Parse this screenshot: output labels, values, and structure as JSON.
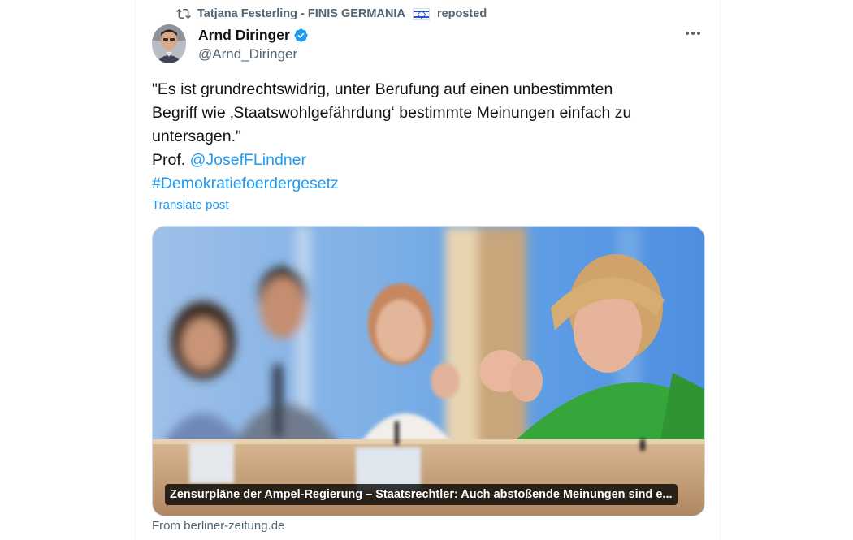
{
  "repost": {
    "reposter": "Tatjana Festerling - FINIS GERMANIA",
    "label": "reposted",
    "icon": "repost-icon",
    "flag": "israel-flag-icon"
  },
  "author": {
    "name": "Arnd Diringer",
    "handle": "@Arnd_Diringer",
    "verified_icon": "verified-badge-icon"
  },
  "tweet": {
    "line1": "\"Es ist grundrechtswidrig, unter Berufung auf einen unbestimmten",
    "line2": "Begriff wie ‚Staatswohlgefährdung‘ bestimmte Meinungen einfach zu",
    "line3": "untersagen.\"",
    "prof_prefix": "Prof. ",
    "mention": "@JosefFLindner",
    "hashtag": "#Demokratiefoerdergesetz"
  },
  "translate_label": "Translate post",
  "card": {
    "caption": "Zensurpläne der Ampel-Regierung – Staatsrechtler: Auch abstoßende Meinungen sind e...",
    "source": "From berliner-zeitung.de"
  },
  "colors": {
    "accent": "#1d9bf0",
    "secondary_text": "#536471",
    "primary_text": "#0f1419"
  }
}
